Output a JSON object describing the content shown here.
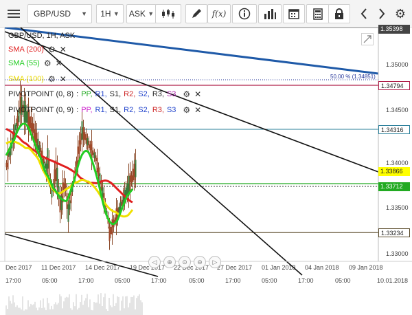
{
  "toolbar": {
    "menu_icon": "hamburger-menu-icon",
    "symbol": "GBP/USD",
    "timeframe": "1H",
    "price_side": "ASK",
    "chart_type_icon": "candlestick-icon",
    "draw_icon": "pencil-icon",
    "function_label": "f(x)",
    "info_icon": "info-icon",
    "indicators_icon": "bar-chart-icon",
    "calendar_icon": "calendar-icon",
    "calculator_icon": "calculator-icon",
    "lock_icon": "lock-icon",
    "prev_icon": "chevron-left-icon",
    "next_icon": "chevron-right-icon",
    "settings_icon": "gear-icon"
  },
  "legend": {
    "title": "GBP/USD, 1H, ASK",
    "sma200": {
      "label": "SMA (200)",
      "color": "#e02020"
    },
    "sma55": {
      "label": "SMA (55)",
      "color": "#22cc22"
    },
    "sma100": {
      "label": "SMA (100)",
      "color": "#f0e000"
    },
    "pivot1": {
      "label": "PIVOTPOINT (0, 8)",
      "items": [
        {
          "text": "PP,",
          "color": "#22aa22"
        },
        {
          "text": "R1,",
          "color": "#2244cc"
        },
        {
          "text": "S1,",
          "color": "#222222"
        },
        {
          "text": "R2,",
          "color": "#cc2222"
        },
        {
          "text": "S2,",
          "color": "#2244cc"
        },
        {
          "text": "R3,",
          "color": "#222222"
        },
        {
          "text": "S3",
          "color": "#aa22aa"
        }
      ]
    },
    "pivot2": {
      "label": "PIVOTPOINT (0, 9)",
      "items": [
        {
          "text": "PP,",
          "color": "#cc22cc"
        },
        {
          "text": "R1,",
          "color": "#2244cc"
        },
        {
          "text": "S1,",
          "color": "#222222"
        },
        {
          "text": "R2,",
          "color": "#2244cc"
        },
        {
          "text": "S2,",
          "color": "#2244cc"
        },
        {
          "text": "R3,",
          "color": "#cc2222"
        },
        {
          "text": "S3",
          "color": "#2244cc"
        }
      ]
    },
    "settings_glyph": "⚙",
    "remove_glyph": "✕"
  },
  "price_axis": {
    "labels": [
      "1.35000",
      "1.34500",
      "1.34000",
      "1.33500",
      "1.33000"
    ],
    "tags": [
      {
        "value": "1.35398",
        "bg": "#444444",
        "fg": "#ffffff"
      },
      {
        "value": "1.34794",
        "bg": "#ffffff",
        "fg": "#222222",
        "border": "#b0204a"
      },
      {
        "value": "1.34316",
        "bg": "#ffffff",
        "fg": "#222222",
        "border": "#2a7f9a"
      },
      {
        "value": "1.33866",
        "bg": "#ffff00",
        "fg": "#222222"
      },
      {
        "value": "1.33712",
        "bg": "#22aa22",
        "fg": "#ffffff"
      },
      {
        "value": "1.33234",
        "bg": "#ffffff",
        "fg": "#222222",
        "border": "#5a4a2a"
      }
    ]
  },
  "fib_label": "50.00 % (1.34851)",
  "date_axis": [
    "Dec 2017",
    "11 Dec 2017",
    "14 Dec 2017",
    "19 Dec 2017",
    "22 Dec 2017",
    "27 Dec 2017",
    "01 Jan 2018",
    "04 Jan 2018",
    "09 Jan 2018"
  ],
  "time_axis": [
    "17:00",
    "05:00",
    "17:00",
    "05:00",
    "17:00",
    "05:00",
    "17:00",
    "05:00",
    "17:00",
    "05:00",
    "10.01.2018"
  ],
  "nav_icons": [
    "scroll-left-icon",
    "zoom-in-icon",
    "zoom-reset-icon",
    "zoom-out-icon",
    "scroll-right-icon"
  ],
  "nav_glyphs": [
    "◁",
    "⊕",
    "⊙",
    "⊖",
    "▷"
  ]
}
